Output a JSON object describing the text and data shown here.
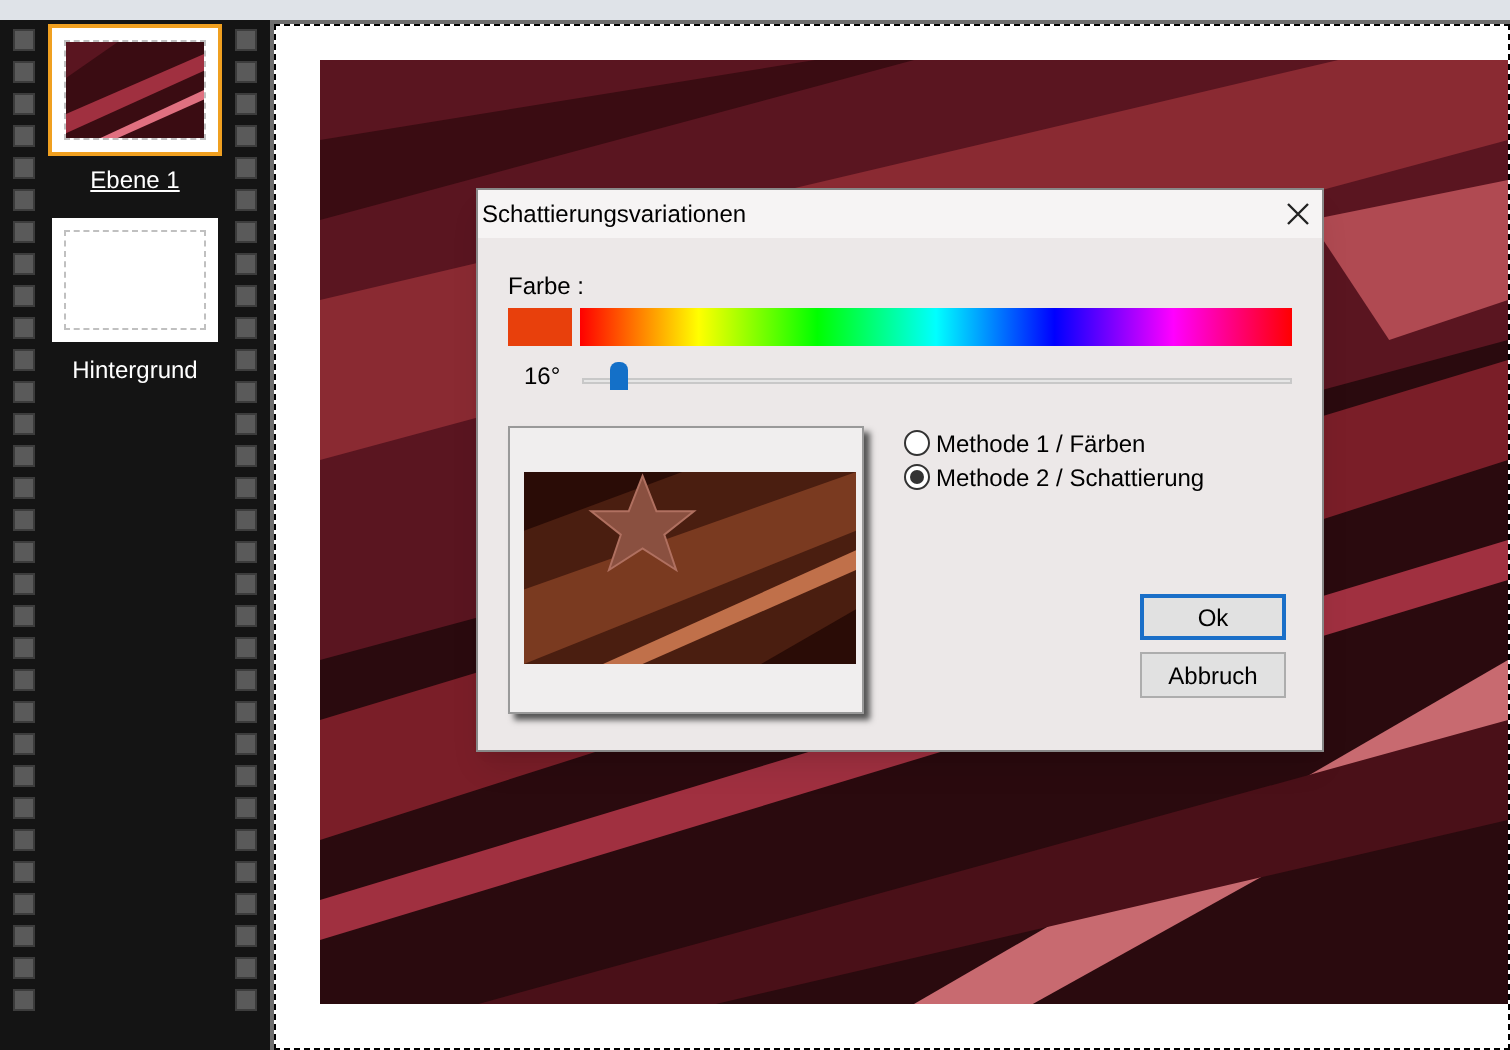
{
  "layers": [
    {
      "label": "Ebene 1",
      "selected": true,
      "kind": "picture"
    },
    {
      "label": "Hintergrund",
      "selected": false,
      "kind": "blank"
    }
  ],
  "dialog": {
    "title": "Schattierungsvariationen",
    "color_label": "Farbe :",
    "color": "#e8400c",
    "hue_reading": "16°",
    "hue": {
      "level": 0.05
    },
    "methods": [
      {
        "label": "Methode 1 / Färben",
        "selected": false
      },
      {
        "label": "Methode 2 / Schattierung",
        "selected": true
      }
    ],
    "buttons": [
      {
        "label": "Ok",
        "default": true
      },
      {
        "label": "Abbruch",
        "default": false
      }
    ]
  }
}
